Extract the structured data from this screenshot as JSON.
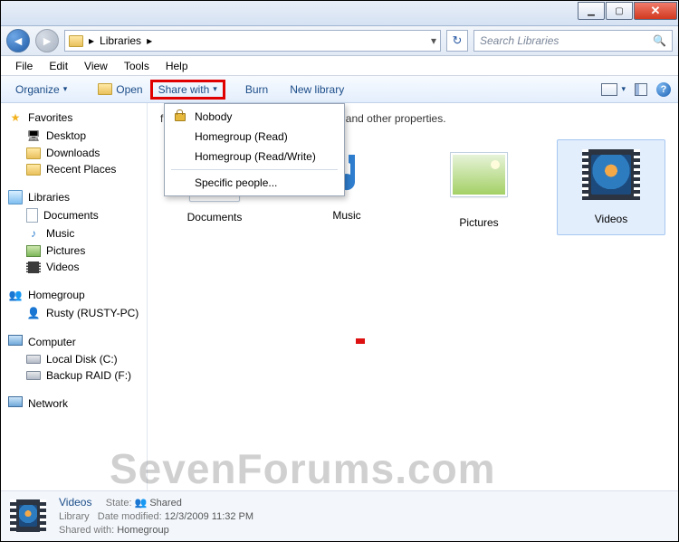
{
  "titlebar": {
    "minimize": "▁",
    "maximize": "▢",
    "close": "✕"
  },
  "nav": {
    "breadcrumb_root": "Libraries",
    "breadcrumb_sep": "▸",
    "search_placeholder": "Search Libraries"
  },
  "menubar": {
    "file": "File",
    "edit": "Edit",
    "view": "View",
    "tools": "Tools",
    "help": "Help"
  },
  "toolbar": {
    "organize": "Organize",
    "open": "Open",
    "share_with": "Share with",
    "burn": "Burn",
    "new_library": "New library"
  },
  "share_menu": {
    "nobody": "Nobody",
    "hg_read": "Homegroup (Read)",
    "hg_rw": "Homegroup (Read/Write)",
    "specific": "Specific people..."
  },
  "header_text": "files and arrange them by folder, date, and other properties.",
  "sidebar": {
    "favorites": "Favorites",
    "desktop": "Desktop",
    "downloads": "Downloads",
    "recent": "Recent Places",
    "libraries": "Libraries",
    "documents": "Documents",
    "music": "Music",
    "pictures": "Pictures",
    "videos": "Videos",
    "homegroup": "Homegroup",
    "rusty": "Rusty (RUSTY-PC)",
    "computer": "Computer",
    "local_disk": "Local Disk (C:)",
    "backup": "Backup RAID (F:)",
    "network": "Network"
  },
  "libraries_grid": {
    "documents": "Documents",
    "music": "Music",
    "pictures": "Pictures",
    "videos": "Videos"
  },
  "details": {
    "title": "Videos",
    "state_label": "State:",
    "state_value": "Shared",
    "type": "Library",
    "mod_label": "Date modified:",
    "mod_value": "12/3/2009 11:32 PM",
    "shared_label": "Shared with:",
    "shared_value": "Homegroup"
  },
  "watermark": "SevenForums.com"
}
